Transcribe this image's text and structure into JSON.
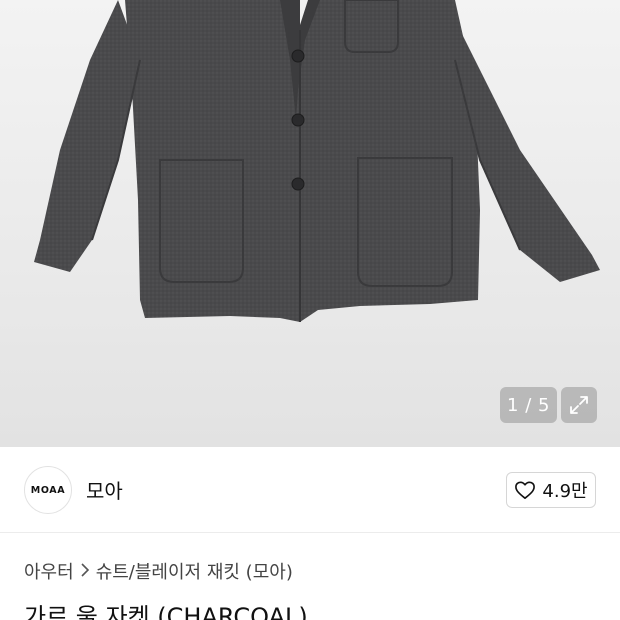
{
  "gallery": {
    "counter_text": "1 / 5",
    "current_index": 1,
    "total": 5,
    "expand_icon": "expand-icon"
  },
  "brand": {
    "logo_text": "MOAA",
    "name": "모아",
    "like_count": "4.9만",
    "like_icon": "heart-outline-icon"
  },
  "breadcrumb": {
    "items": [
      "아우터",
      "슈트/블레이저 재킷 (모아)"
    ],
    "separator_icon": "chevron-right-icon"
  },
  "product": {
    "title": "가르 울 자켓 (CHARCOAL)"
  },
  "colors": {
    "jacket": "#4b4b4d",
    "badge_bg": "#969696",
    "text": "#111111"
  }
}
